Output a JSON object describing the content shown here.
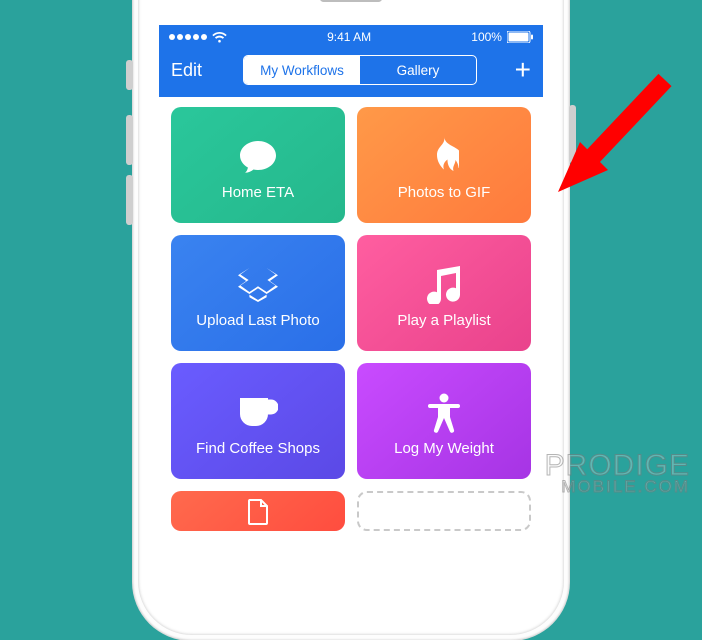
{
  "status": {
    "time": "9:41 AM",
    "battery": "100%"
  },
  "nav": {
    "edit": "Edit",
    "seg_my": "My Workflows",
    "seg_gallery": "Gallery",
    "plus": "+"
  },
  "tiles": [
    {
      "label": "Home ETA",
      "icon": "speech-bubble-icon",
      "style": "t-green"
    },
    {
      "label": "Photos to GIF",
      "icon": "flame-icon",
      "style": "t-orange"
    },
    {
      "label": "Upload Last Photo",
      "icon": "dropbox-icon",
      "style": "t-blue"
    },
    {
      "label": "Play a Playlist",
      "icon": "music-note-icon",
      "style": "t-pink"
    },
    {
      "label": "Find Coffee Shops",
      "icon": "coffee-cup-icon",
      "style": "t-indigo"
    },
    {
      "label": "Log My Weight",
      "icon": "body-icon",
      "style": "t-purple"
    }
  ],
  "watermark": {
    "line1": "PRODIGE",
    "line2": "MOBILE.COM"
  }
}
